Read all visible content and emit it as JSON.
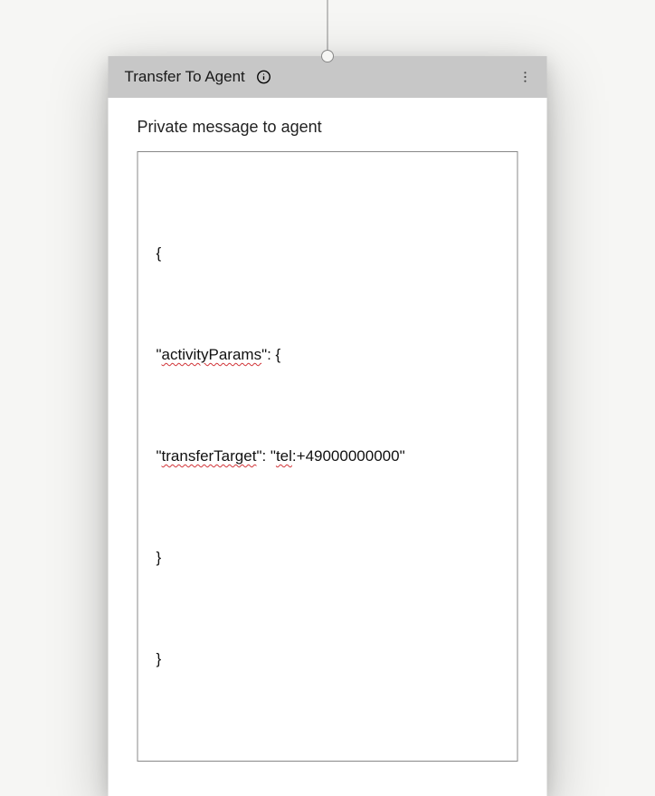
{
  "card": {
    "title": "Transfer To Agent",
    "field_label": "Private message to agent"
  },
  "content": {
    "line1_open": "{",
    "line2_prefix": "\"",
    "line2_word": "activityParams",
    "line2_suffix": "\": {",
    "line3_prefix": "\"",
    "line3_word1": "transferTarget",
    "line3_mid": "\": \"",
    "line3_word2": "tel",
    "line3_suffix": ":+49000000000\"",
    "line4_close": "}",
    "line5_close": "}"
  }
}
